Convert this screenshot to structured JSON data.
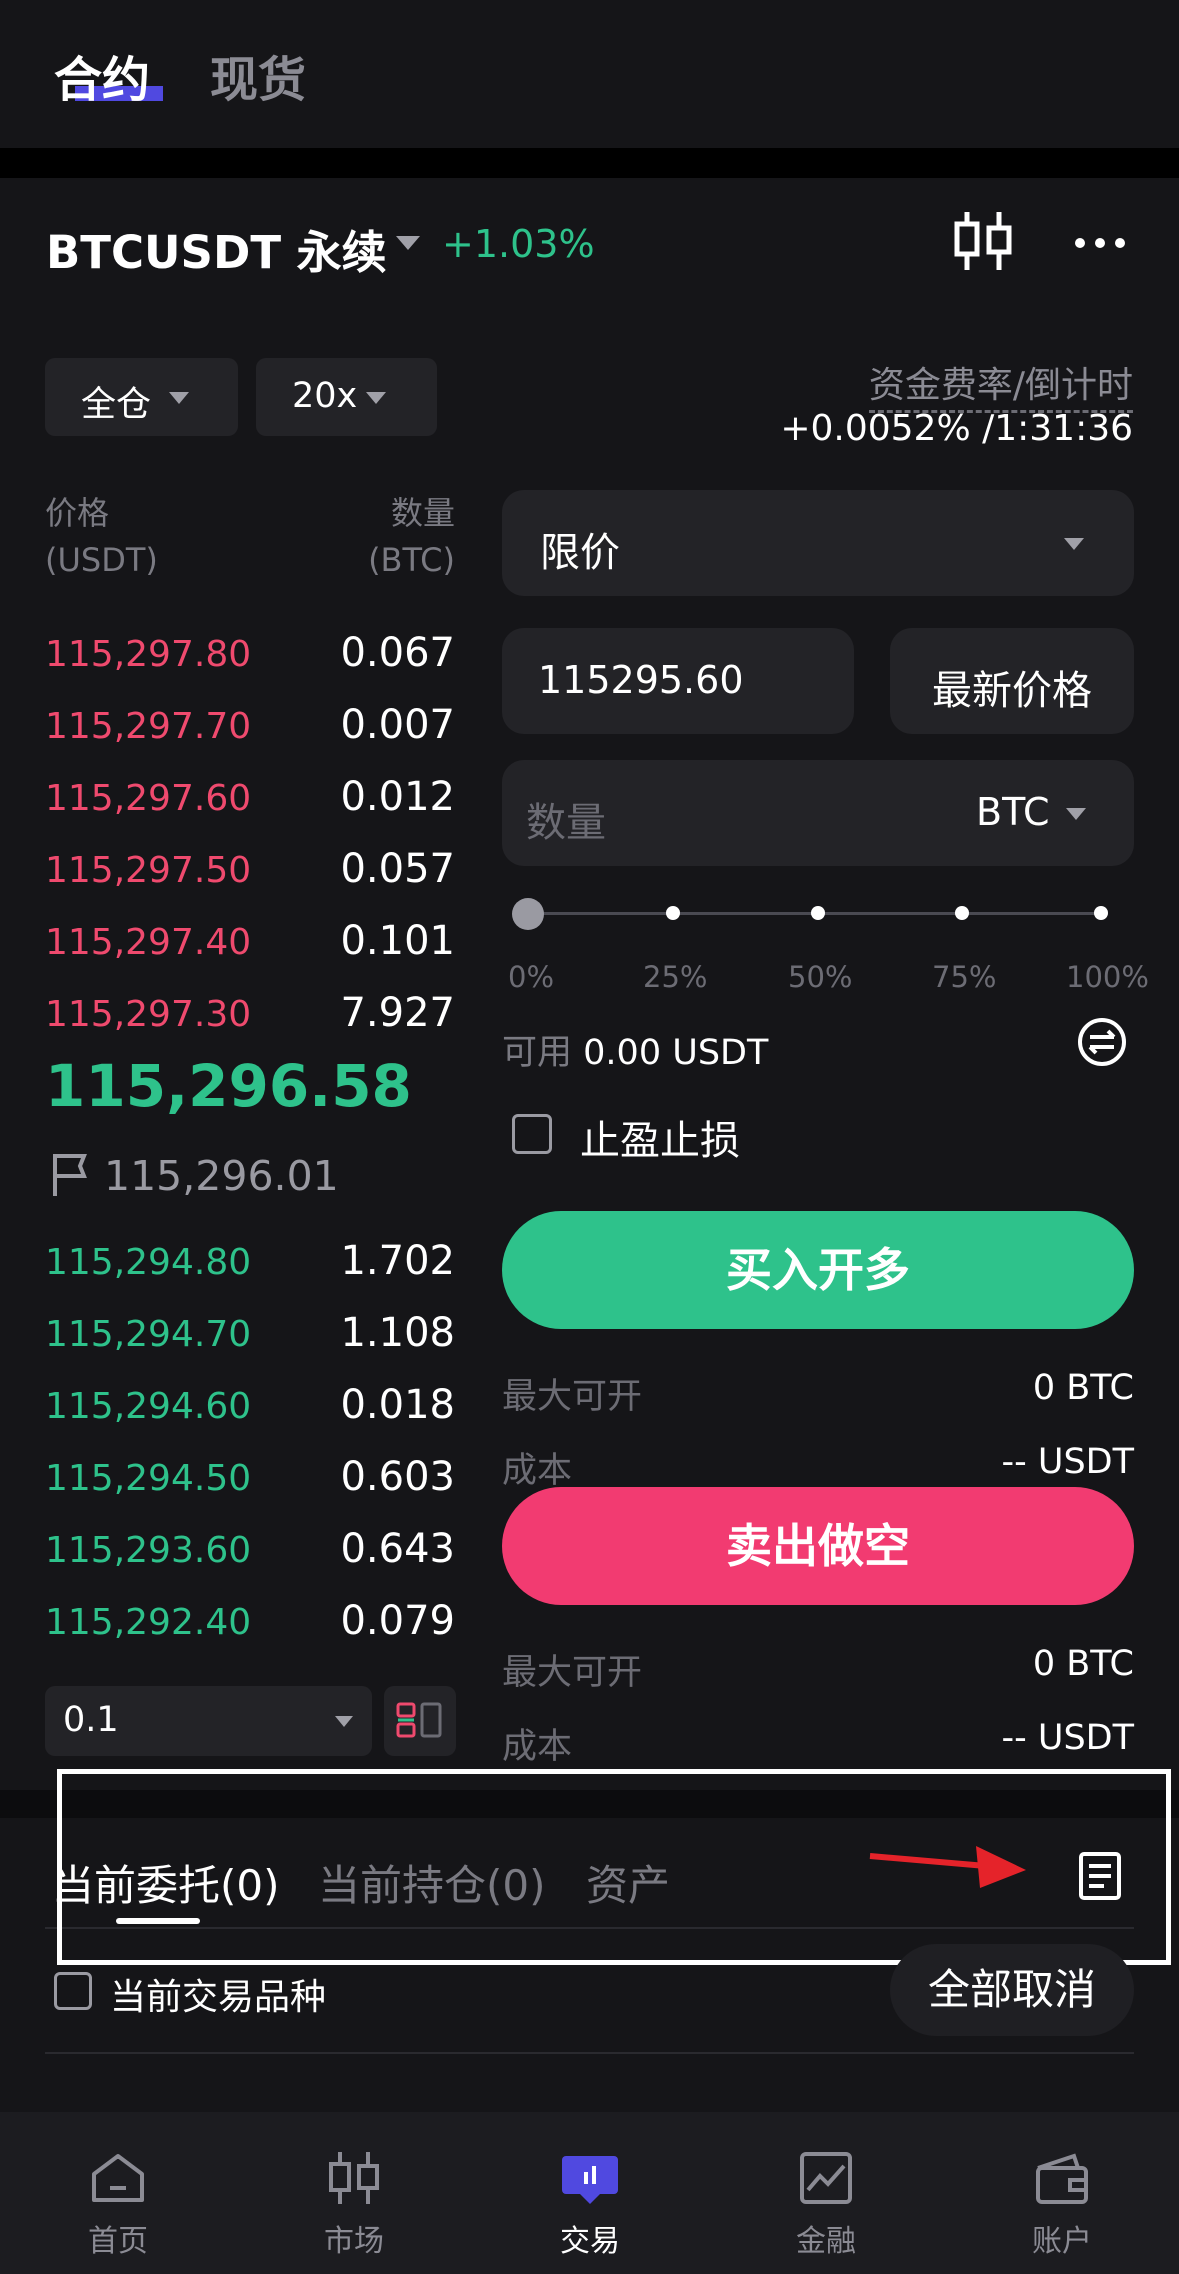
{
  "top_tabs": {
    "futures": "合约",
    "spot": "现货"
  },
  "pair": {
    "symbol": "BTCUSDT 永续",
    "change": "+1.03%"
  },
  "controls": {
    "margin_mode": "全仓",
    "leverage": "20x"
  },
  "funding": {
    "label": "资金费率/倒计时",
    "value": "+0.0052% /1:31:36"
  },
  "orderbook": {
    "price_header": [
      "价格",
      "(USDT)"
    ],
    "qty_header": [
      "数量",
      "(BTC)"
    ],
    "asks": [
      {
        "price": "115,297.80",
        "qty": "0.067"
      },
      {
        "price": "115,297.70",
        "qty": "0.007"
      },
      {
        "price": "115,297.60",
        "qty": "0.012"
      },
      {
        "price": "115,297.50",
        "qty": "0.057"
      },
      {
        "price": "115,297.40",
        "qty": "0.101"
      },
      {
        "price": "115,297.30",
        "qty": "7.927"
      }
    ],
    "last_price": "115,296.58",
    "mark_price": "115,296.01",
    "bids": [
      {
        "price": "115,294.80",
        "qty": "1.702"
      },
      {
        "price": "115,294.70",
        "qty": "1.108"
      },
      {
        "price": "115,294.60",
        "qty": "0.018"
      },
      {
        "price": "115,294.50",
        "qty": "0.603"
      },
      {
        "price": "115,293.60",
        "qty": "0.643"
      },
      {
        "price": "115,292.40",
        "qty": "0.079"
      }
    ],
    "depth": "0.1"
  },
  "form": {
    "order_type": "限价",
    "price": "115295.60",
    "latest_price_btn": "最新价格",
    "qty_placeholder": "数量",
    "qty_unit": "BTC",
    "slider_labels": [
      "0%",
      "25%",
      "50%",
      "75%",
      "100%"
    ],
    "slider_value": 0,
    "available_label": "可用",
    "available_value": "0.00 USDT",
    "tpsl_label": "止盈止损",
    "buy_label": "买入开多",
    "sell_label": "卖出做空",
    "buy_info": [
      {
        "label": "最大可开",
        "value": "0 BTC"
      },
      {
        "label": "成本",
        "value": "-- USDT"
      }
    ],
    "sell_info": [
      {
        "label": "最大可开",
        "value": "0 BTC"
      },
      {
        "label": "成本",
        "value": "-- USDT"
      }
    ]
  },
  "orders_panel": {
    "tabs": [
      "当前委托(0)",
      "当前持仓(0)",
      "资产"
    ],
    "current_pair_label": "当前交易品种",
    "cancel_all": "全部取消"
  },
  "nav": {
    "items": [
      {
        "label": "首页",
        "icon": "home-icon"
      },
      {
        "label": "市场",
        "icon": "market-icon"
      },
      {
        "label": "交易",
        "icon": "trade-icon"
      },
      {
        "label": "金融",
        "icon": "finance-icon"
      },
      {
        "label": "账户",
        "icon": "wallet-icon"
      }
    ],
    "active": "交易"
  },
  "colors": {
    "up": "#2ec28b",
    "down": "#ef4a6e",
    "sell_button": "#f23b71",
    "accent": "#5049e0"
  }
}
